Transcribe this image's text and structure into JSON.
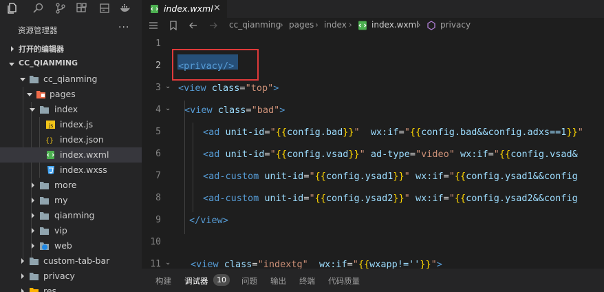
{
  "sidebar": {
    "title": "资源管理器",
    "more": "···",
    "sections": {
      "open_editors": "打开的编辑器",
      "project": "CC_QIANMING"
    },
    "tree": [
      {
        "label": "cc_qianming",
        "kind": "folder",
        "open": true
      },
      {
        "label": "pages",
        "kind": "folder-special",
        "open": true
      },
      {
        "label": "index",
        "kind": "folder",
        "open": true
      },
      {
        "label": "index.js",
        "kind": "js"
      },
      {
        "label": "index.json",
        "kind": "json"
      },
      {
        "label": "index.wxml",
        "kind": "wxml",
        "selected": true
      },
      {
        "label": "index.wxss",
        "kind": "wxss"
      },
      {
        "label": "more",
        "kind": "folder"
      },
      {
        "label": "my",
        "kind": "folder"
      },
      {
        "label": "qianming",
        "kind": "folder"
      },
      {
        "label": "vip",
        "kind": "folder"
      },
      {
        "label": "web",
        "kind": "folder-web"
      },
      {
        "label": "custom-tab-bar",
        "kind": "folder"
      },
      {
        "label": "privacy",
        "kind": "folder"
      },
      {
        "label": "res",
        "kind": "folder-special"
      }
    ]
  },
  "tab": {
    "label": "index.wxml",
    "close": "×"
  },
  "breadcrumb": [
    "cc_qianming",
    "pages",
    "index",
    "index.wxml",
    "privacy"
  ],
  "editor": {
    "line_numbers": [
      "1",
      "2",
      "3",
      "4",
      "5",
      "6",
      "7",
      "8",
      "9",
      "10",
      "11"
    ],
    "lines": {
      "l2": {
        "t1": "<privacy/>"
      },
      "l3": {
        "a": "<view",
        "b": " class",
        "c": "=",
        "d": "\"top\"",
        "e": ">"
      },
      "l4": {
        "a": "<view",
        "b": " class",
        "c": "=",
        "d": "\"bad\"",
        "e": ">"
      },
      "l5": {
        "a": "<ad",
        "b": " unit-id",
        "c": "=",
        "d": "\"",
        "e": "{{",
        "f": "config.bad",
        "g": "}}",
        "h": "\"",
        "i": "  wx:if",
        "j": "=",
        "k": "\"",
        "l": "{{",
        "m": "config.bad&&config.adxs==1",
        "n": "}}",
        "o": "\""
      },
      "l6": {
        "a": "<ad",
        "b": " unit-id",
        "c": "=",
        "d": "\"",
        "e": "{{",
        "f": "config.vsad",
        "g": "}}",
        "h": "\"",
        "i": " ad-type",
        "j": "=",
        "k": "\"video\"",
        "l": " wx:if",
        "m": "=",
        "n": "\"",
        "o": "{{",
        "p": "config.vsad&"
      },
      "l7": {
        "a": "<ad-custom",
        "b": " unit-id",
        "c": "=",
        "d": "\"",
        "e": "{{",
        "f": "config.ysad1",
        "g": "}}",
        "h": "\"",
        "i": " wx:if",
        "j": "=",
        "k": "\"",
        "l": "{{",
        "m": "config.ysad1&&config"
      },
      "l8": {
        "a": "<ad-custom",
        "b": " unit-id",
        "c": "=",
        "d": "\"",
        "e": "{{",
        "f": "config.ysad2",
        "g": "}}",
        "h": "\"",
        "i": " wx:if",
        "j": "=",
        "k": "\"",
        "l": "{{",
        "m": "config.ysad2&&config"
      },
      "l9": {
        "a": "</view>"
      },
      "l11": {
        "a": "<view",
        "b": " class",
        "c": "=",
        "d": "\"indextg\"",
        "e": "  wx:if",
        "f": "=",
        "g": "\"",
        "h": "{{",
        "i": "wxapp!=''",
        "j": "}}",
        "k": "\"",
        "l": ">"
      }
    }
  },
  "panel": {
    "tabs": [
      "构建",
      "调试器",
      "问题",
      "输出",
      "终端",
      "代码质量"
    ],
    "badge": "10"
  },
  "colors": {
    "tag": "#569cd6",
    "attr": "#9cdcfe",
    "string": "#ce9178",
    "bracket": "#ffd700",
    "highlight_box": "#e03a3a",
    "selection": "#264f78"
  }
}
